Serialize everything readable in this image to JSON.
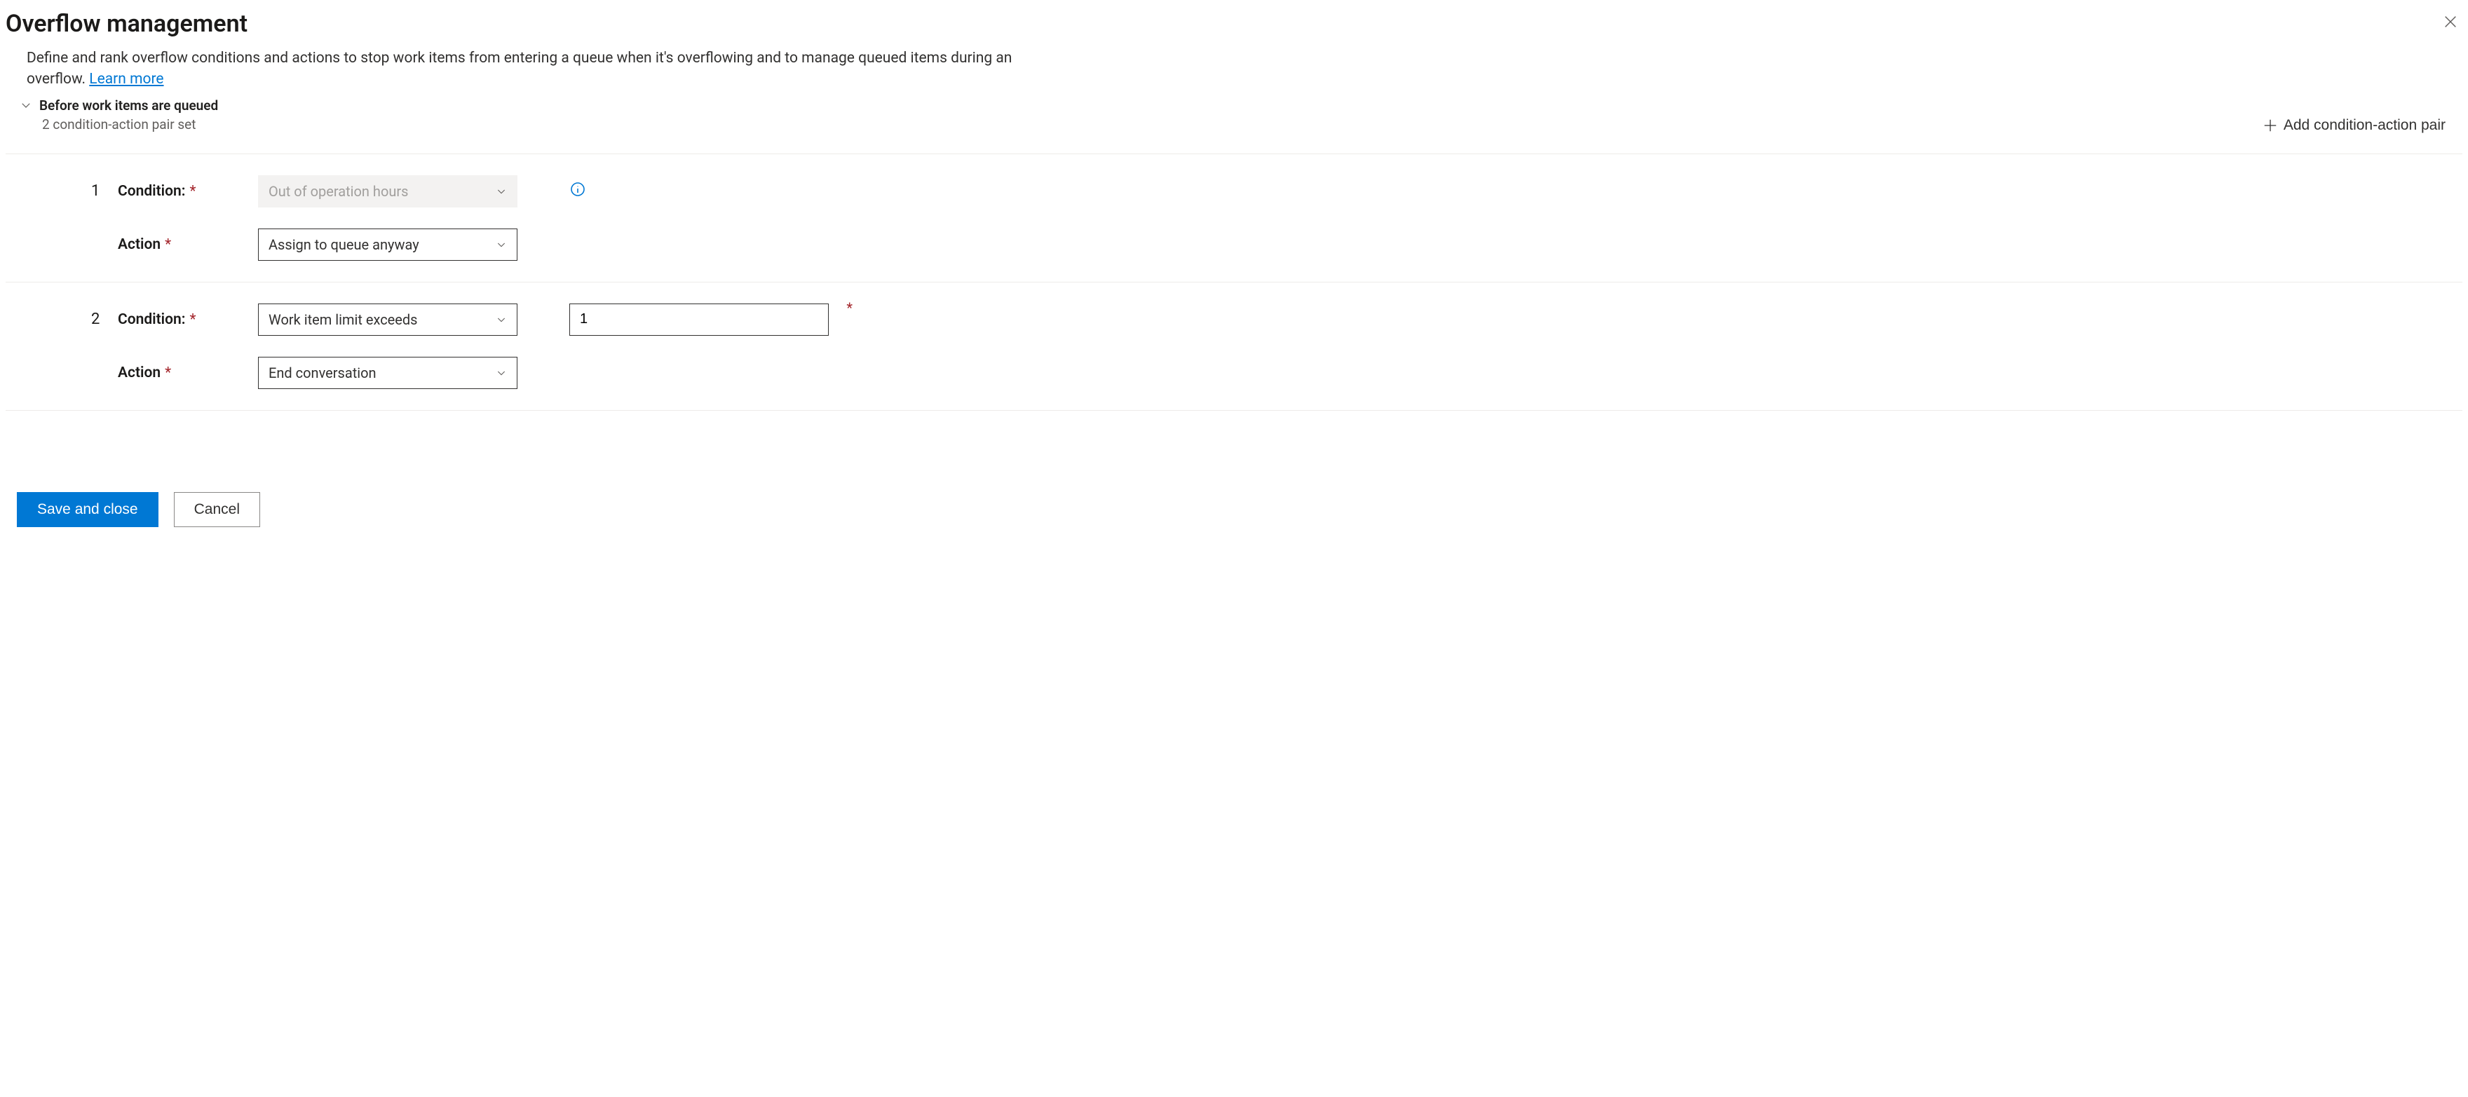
{
  "header": {
    "title": "Overflow management",
    "description_pre": "Define and rank overflow conditions and actions to stop work items from entering a queue when it's overflowing and to manage queued items during an overflow. ",
    "learn_more_label": "Learn more"
  },
  "section": {
    "title": "Before work items are queued",
    "subtitle": "2 condition-action pair set",
    "add_pair_label": "Add condition-action pair"
  },
  "labels": {
    "condition": "Condition:",
    "action": "Action"
  },
  "pairs": [
    {
      "ordinal": "1",
      "condition_value": "Out of operation hours",
      "condition_disabled": true,
      "has_info": true,
      "action_value": "Assign to queue anyway",
      "extra_value": null
    },
    {
      "ordinal": "2",
      "condition_value": "Work item limit exceeds",
      "condition_disabled": false,
      "has_info": false,
      "action_value": "End conversation",
      "extra_value": "1"
    }
  ],
  "footer": {
    "save_label": "Save and close",
    "cancel_label": "Cancel"
  }
}
